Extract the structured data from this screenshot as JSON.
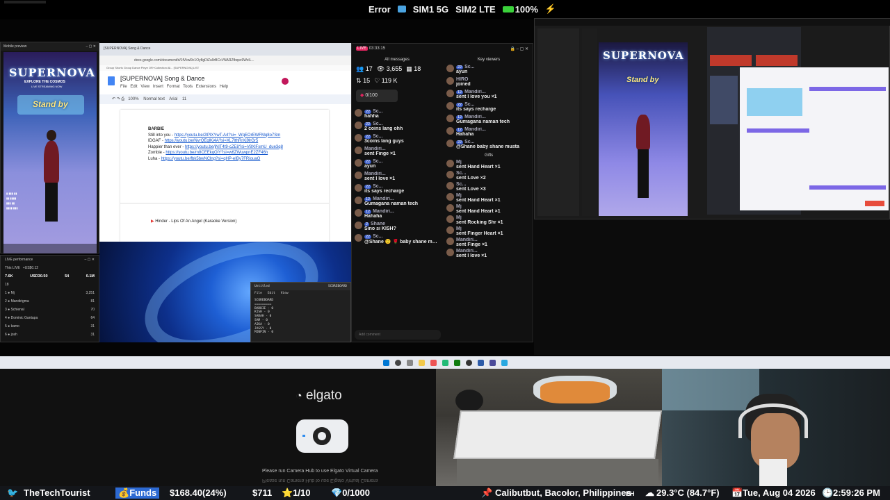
{
  "status": {
    "error": "Error",
    "sim1": "SIM1 5G",
    "sim2": "SIM2 LTE",
    "battery": "100%"
  },
  "mobile": {
    "title": "Mobile preview",
    "logo": "SUPERNOVA",
    "tagline": "EXPLORE THE COSMOS",
    "live": "LIVE STREAMING NOW",
    "stand_by": "Stand by"
  },
  "liveperf": {
    "title": "LIVE performance",
    "period": "This LIVE",
    "compare": "+US$0.12",
    "stats": [
      "7.6K",
      "USD30.50",
      "54",
      "0.1M"
    ],
    "rank_label": "18",
    "rows": [
      {
        "n": "1",
        "name": "Mj",
        "v": "3,251"
      },
      {
        "n": "2",
        "name": "Mandirigma",
        "v": "81"
      },
      {
        "n": "3",
        "name": "SchienaI",
        "v": "70"
      },
      {
        "n": "4",
        "name": "Dominic Gantapa",
        "v": "64"
      },
      {
        "n": "5",
        "name": "kamo",
        "v": "31"
      },
      {
        "n": "6",
        "name": "josh",
        "v": "31"
      }
    ]
  },
  "docs": {
    "tab": "[SUPERNOVA] Song & Dance",
    "url": "docs.google.com/document/d/1fVkwRc1Oy8gDiZu9rBCcVNARZfbqsx9WzlL...",
    "bookmarks": "Group Shorts   Group Dance   Pleye   OR+Collection All...   [SUPERNOVA] LIST",
    "title": "[SUPERNOVA] Song & Dance",
    "menu": "File  Edit  View  Insert  Format  Tools  Extensions  Help",
    "zoom": "100%",
    "style": "Normal text",
    "font": "Arial",
    "size": "11",
    "heading": "BARBIE",
    "lines": [
      {
        "t": "Still into you - ",
        "l": "https://youtu.be/2lPlXYwT-A4?si=_WqEOrEWFMq8o7Sm"
      },
      {
        "t": "IDGAF - ",
        "l": "https://youtu.be/NvrQEqlKj4A?si=XL7lthRrXj9lrGr5"
      },
      {
        "t": "Happier than ever - ",
        "l": "https://youtu.be/jNlT4t9-cZE8?si=V8XlFxmU_due3q8"
      },
      {
        "t": "Zombie - ",
        "l": "https://youtu.be/m8CEEkqOiY?si=w6ZWuwpnE2ZF46h"
      },
      {
        "t": "Luha - ",
        "l": "https://youtu.be/fbk5bwNClng?si=qHP-eIBy7FRiouaO"
      }
    ],
    "song": "Hinder - Lips Of An Angel (Karaoke Version)"
  },
  "notepad": {
    "title": "Untitled",
    "badge": "SCOREBOARD",
    "menu": [
      "File",
      "Edit",
      "View"
    ],
    "lines": [
      "SCOREBOARD",
      "=========",
      "BARBIE - 0",
      "KISH - 0",
      "SARAH - 0",
      "SAM - 0",
      "AIKA - 0",
      "JASSY - 0",
      "MINPIN - 0"
    ]
  },
  "chat": {
    "time": "03:33:15",
    "all": "All messages",
    "key": "Key viewers",
    "gifts": "Gifts",
    "stats": [
      {
        "i": "👥",
        "v": "17"
      },
      {
        "i": "👁",
        "v": "3,655"
      },
      {
        "i": "▦",
        "v": "18"
      },
      {
        "i": "⇅",
        "v": "15"
      },
      {
        "i": "♡",
        "v": "119 K"
      }
    ],
    "goal": "0/100",
    "left": [
      {
        "name": "Sc...",
        "lv": "22",
        "text": "hahha"
      },
      {
        "name": "Sc...",
        "lv": "22",
        "text": "2 coins lang ohh"
      },
      {
        "name": "Sc...",
        "lv": "22",
        "text": "3coins lang guys"
      },
      {
        "name": "Mandiri...",
        "lv": "",
        "text": "sent Finge ×1"
      },
      {
        "name": "Sc...",
        "lv": "22",
        "text": "ayun"
      },
      {
        "name": "Mandiri...",
        "lv": "",
        "text": "sent I love ×1"
      },
      {
        "name": "Sc...",
        "lv": "22",
        "text": "its says recharge"
      },
      {
        "name": "Mandiri...",
        "lv": "12",
        "text": "Gumagana naman tech"
      },
      {
        "name": "Mandiri...",
        "lv": "12",
        "text": "Hahaha"
      },
      {
        "name": "Shane",
        "lv": "2",
        "text": "Sino si KISH?"
      },
      {
        "name": "Sc...",
        "lv": "22",
        "text": "@Shane 🙂 🌹 baby shane musta"
      }
    ],
    "right": [
      {
        "name": "Sc...",
        "lv": "22",
        "text": "ayun"
      },
      {
        "name": "HIRO",
        "lv": "",
        "text": "joined"
      },
      {
        "name": "Mandiri...",
        "lv": "12",
        "text": "sent I love you ×1"
      },
      {
        "name": "Sc...",
        "lv": "22",
        "text": "its says recharge"
      },
      {
        "name": "Mandiri...",
        "lv": "12",
        "text": "Gumagana naman tech"
      },
      {
        "name": "Mandiri...",
        "lv": "12",
        "text": "Hahaha"
      },
      {
        "name": "Sc...",
        "lv": "22",
        "text": "@Shane baby shane musta"
      }
    ],
    "gifts_list": [
      {
        "name": "Mj",
        "text": "sent Hand Heart ×1"
      },
      {
        "name": "Sc...",
        "text": "sent Love ×2"
      },
      {
        "name": "Sc...",
        "text": "sent Love ×3"
      },
      {
        "name": "Mj",
        "text": "sent Hand Heart ×1"
      },
      {
        "name": "Mj",
        "text": "sent Hand Heart ×1"
      },
      {
        "name": "Mj",
        "text": "sent Rocking Shr ×1"
      },
      {
        "name": "Mj",
        "text": "sent Finger Heart ×1"
      },
      {
        "name": "Mandiri...",
        "text": "sent Finge ×1"
      },
      {
        "name": "Mandiri...",
        "text": "sent I love ×1"
      }
    ],
    "input_placeholder": "Add comment"
  },
  "elgato": {
    "brand": "elgato",
    "message": "Please run Camera Hub to use Elgato Virtual Camera"
  },
  "ticker": {
    "handle": "TheTechTourist",
    "funds": "Funds",
    "amount": "$168.40(24%)",
    "dollar": "$711",
    "stars": "1/10",
    "gems": "0/1000",
    "location": "Calibutbut, Bacolor, Philippines",
    "cc": "PH",
    "weather": "29.3°C (84.7°F)",
    "date": "Tue, Aug 04 2026",
    "time": "2:59:26 PM"
  },
  "colors": {
    "accent": "#3e5fc9",
    "ticker_bg": "#14161a",
    "taskbar": "#e6e9ef"
  }
}
